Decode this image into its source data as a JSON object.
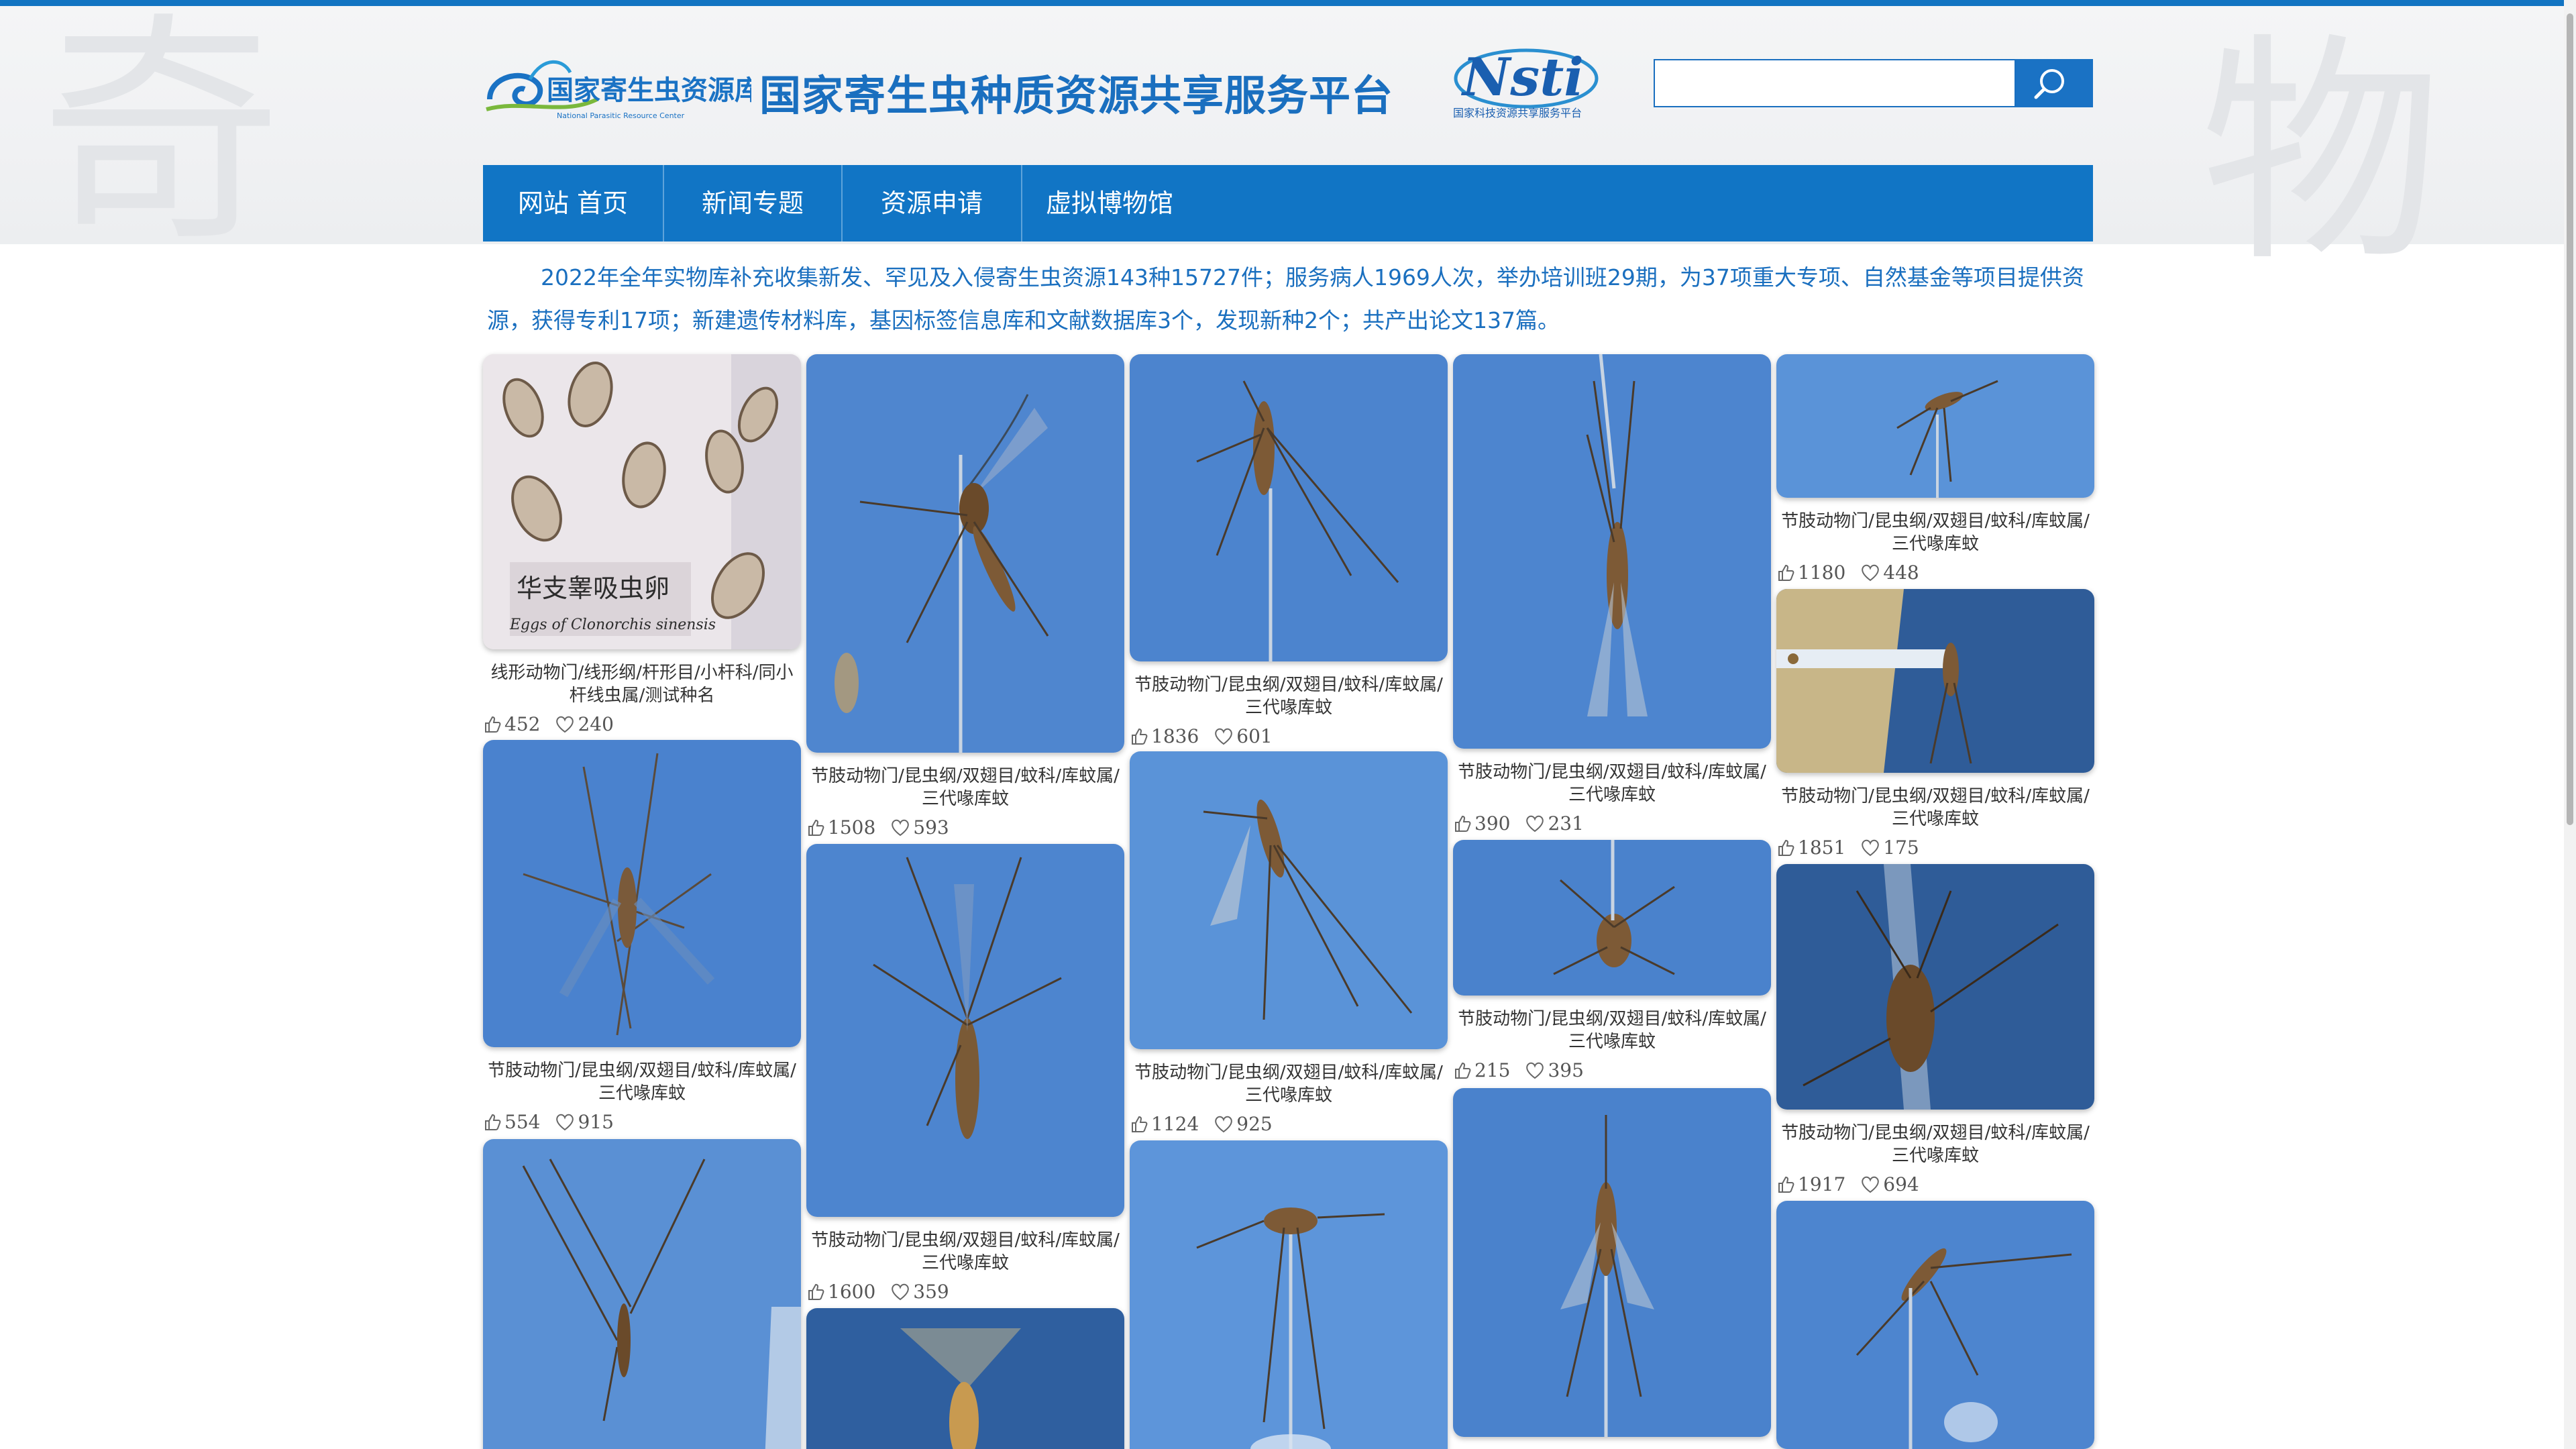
{
  "header": {
    "logo_text": "国家寄生虫资源库",
    "logo_subtext": "National Parasitic Resource Center",
    "site_title": "国家寄生虫种质资源共享服务平台",
    "partner_logo_text": "Nsti",
    "partner_logo_sub": "国家科技资源共享服务平台",
    "search_placeholder": "",
    "search_icon": "search-icon"
  },
  "nav": {
    "items": [
      {
        "label": "网站 首页"
      },
      {
        "label": "新闻专题"
      },
      {
        "label": "资源申请"
      },
      {
        "label": "虚拟博物馆"
      }
    ]
  },
  "intro": "2022年全年实物库补充收集新发、罕见及入侵寄生虫资源143种15727件；服务病人1969人次，举办培训班29期，为37项重大专项、自然基金等项目提供资源，获得专利17项；新建遗传材料库，基因标签信息库和文献数据库3个，发现新种2个；共产出论文137篇。",
  "colors": {
    "brand_blue": "#1175c5",
    "text_blue": "#1a6fbf",
    "photo_blue": "#4f86cf"
  },
  "cards": [
    {
      "caption": "线形动物门/线形纲/杆形目/小杆科/同小杆线虫属/测试种名",
      "likes": "452",
      "favs": "240",
      "photo_label": "华支睾吸虫卵",
      "photo_sub": "Eggs of Clonorchis sinensis"
    },
    {
      "caption": "节肢动物门/昆虫纲/双翅目/蚊科/库蚊属/三代喙库蚊",
      "likes": "554",
      "favs": "915"
    },
    {
      "caption": "节肢动物门/昆虫纲/双翅目/蚊科/库蚊属/三代喙库蚊",
      "likes": "1508",
      "favs": "593"
    },
    {
      "caption": "节肢动物门/昆虫纲/双翅目/蚊科/库蚊属/三代喙库蚊",
      "likes": "1600",
      "favs": "359"
    },
    {
      "caption": "节肢动物门/昆虫纲/双翅目/蚊科/库蚊属/三代喙库蚊",
      "likes": "1836",
      "favs": "601"
    },
    {
      "caption": "节肢动物门/昆虫纲/双翅目/蚊科/库蚊属/三代喙库蚊",
      "likes": "1124",
      "favs": "925"
    },
    {
      "caption": "节肢动物门/昆虫纲/双翅目/蚊科/库蚊属/三代喙库蚊",
      "likes": "390",
      "favs": "231"
    },
    {
      "caption": "节肢动物门/昆虫纲/双翅目/蚊科/库蚊属/三代喙库蚊",
      "likes": "215",
      "favs": "395"
    },
    {
      "caption": "节肢动物门/昆虫纲/双翅目/蚊科/库蚊属/三代喙库蚊",
      "likes": "1180",
      "favs": "448"
    },
    {
      "caption": "节肢动物门/昆虫纲/双翅目/蚊科/库蚊属/三代喙库蚊",
      "likes": "1851",
      "favs": "175"
    },
    {
      "caption": "节肢动物门/昆虫纲/双翅目/蚊科/库蚊属/三代喙库蚊",
      "likes": "1917",
      "favs": "694"
    }
  ]
}
